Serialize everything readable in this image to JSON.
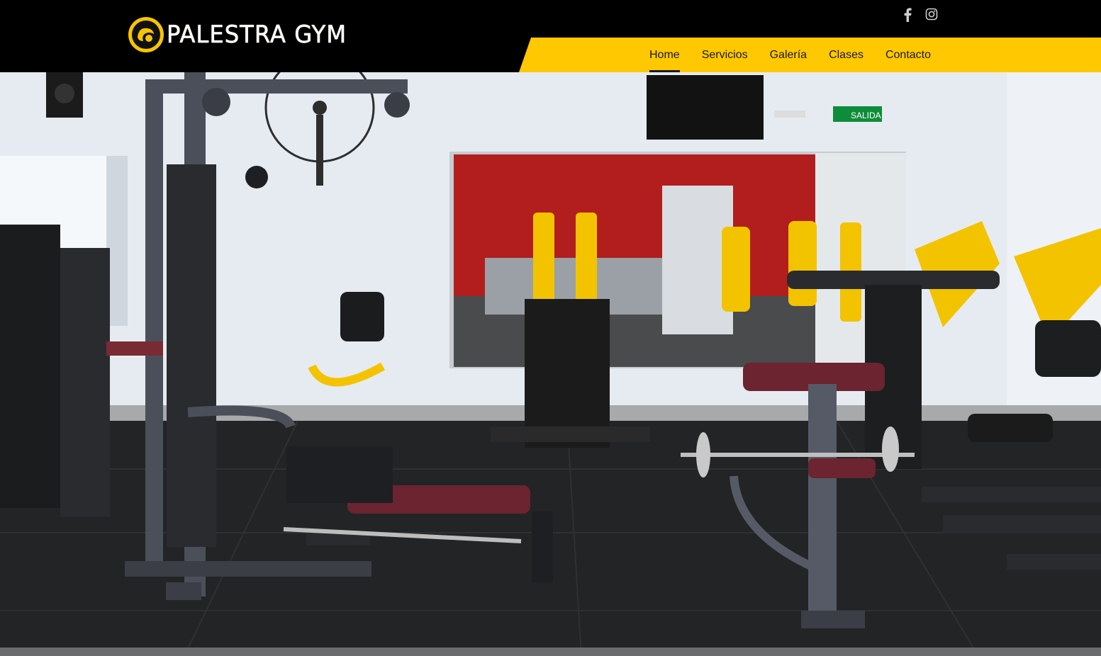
{
  "brand": {
    "name": "PALESTRA GYM",
    "accent": "#ffc800"
  },
  "social": [
    {
      "name": "facebook",
      "glyph": "f"
    },
    {
      "name": "instagram",
      "glyph": "◎"
    }
  ],
  "nav": {
    "items": [
      {
        "label": "Home",
        "active": true
      },
      {
        "label": "Servicios",
        "active": false
      },
      {
        "label": "Galería",
        "active": false
      },
      {
        "label": "Clases",
        "active": false
      },
      {
        "label": "Contacto",
        "active": false
      }
    ]
  },
  "hero": {
    "exit_sign": "SALIDA"
  }
}
